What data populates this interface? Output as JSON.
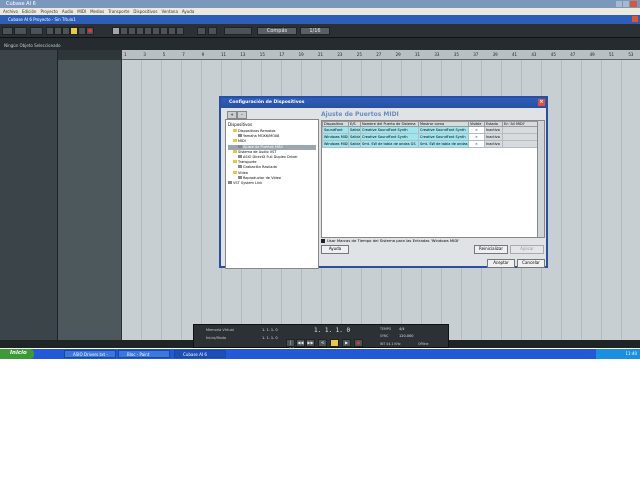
{
  "window": {
    "title": "Cubase AI 6",
    "project_title": "Cubase AI 6 Proyecto - Sin Título1"
  },
  "menu": [
    "Archivo",
    "Edición",
    "Proyecto",
    "Audio",
    "MIDI",
    "Medios",
    "Transporte",
    "Dispositivos",
    "Ventana",
    "Ayuda"
  ],
  "toolbar": {
    "mode_select": "Compás",
    "zoom_value": "1/16"
  },
  "info_line": "Ningún Objeto Seleccionado",
  "ruler": [
    "1",
    "3",
    "5",
    "7",
    "9",
    "11",
    "13",
    "15",
    "17",
    "19",
    "21",
    "23",
    "25",
    "27",
    "29",
    "31",
    "33",
    "35",
    "37",
    "39",
    "41",
    "43",
    "45",
    "47",
    "49",
    "51",
    "53"
  ],
  "dialog": {
    "title": "Configuración de Dispositivos",
    "left_header": "Dispositivos",
    "tree": [
      {
        "label": "Dispositivos Remotos",
        "level": 1
      },
      {
        "label": "Yamaha MOX6/MOX8",
        "level": 2
      },
      {
        "label": "MIDI",
        "level": 1
      },
      {
        "label": "Ajuste de Puertos MIDI",
        "level": 2
      },
      {
        "label": "Sistema de Audio VST",
        "level": 1
      },
      {
        "label": "ASIO DirectX Full Duplex Driver",
        "level": 2
      },
      {
        "label": "Transporte",
        "level": 1
      },
      {
        "label": "Grabación Rasilada",
        "level": 2
      },
      {
        "label": "Vídeo",
        "level": 1
      },
      {
        "label": "Reproductor de Vídeo",
        "level": 2
      },
      {
        "label": "VST System Link",
        "level": 0
      }
    ],
    "panel_title": "Ajuste de Puertos MIDI",
    "columns": [
      "Dispositivo",
      "E/S",
      "Nombre del Puerto de Sistema",
      "Mostrar como",
      "Visible",
      "Estado",
      "En 'All MIDI'"
    ],
    "rows": [
      [
        "SoundFont",
        "Salida",
        "Creative SoundFont Synth",
        "Creative SoundFont Synth",
        "×",
        "Inactivo",
        ""
      ],
      [
        "Windows MIDI",
        "Salida",
        "Creative SoundFont Synth",
        "Creative SoundFont Synth",
        "×",
        "Inactivo",
        ""
      ],
      [
        "Windows MIDI",
        "Salida",
        "Smt. SW de tabla de ondas GS",
        "Smt. SW de tabla de ondas GS",
        "×",
        "Inactivo",
        ""
      ]
    ],
    "checkbox_label": "Usar Marcas de Tiempo del Sistema para las Entradas 'Windows MIDI'",
    "help_button": "Ayuda",
    "reset_button": "Reinicializar",
    "apply_button": "Aplicar",
    "accept_button": "Aceptar",
    "cancel_button": "Cancelar"
  },
  "transport": {
    "memory_label": "Memoria Virtual",
    "loop_label": "Ínicio/Modo",
    "pos_a": "1.  1.  1.  0",
    "pos_b": "1.  1.  1.  0",
    "main_pos": "1. 1. 1.  0",
    "tempo_mode": "TEMPO",
    "tempo_val": "120.000",
    "sig": "4/4",
    "sync": "SYNC",
    "tc": "INT",
    "clk": "INT 44.1 KHz",
    "offline": "Offline"
  },
  "taskbar": {
    "start": "Inicio",
    "items": [
      "ASIO Drivers.txt - Bloc de notas",
      "Bloc - Paint",
      "Cubase AI 6"
    ],
    "clock": "11:40"
  }
}
